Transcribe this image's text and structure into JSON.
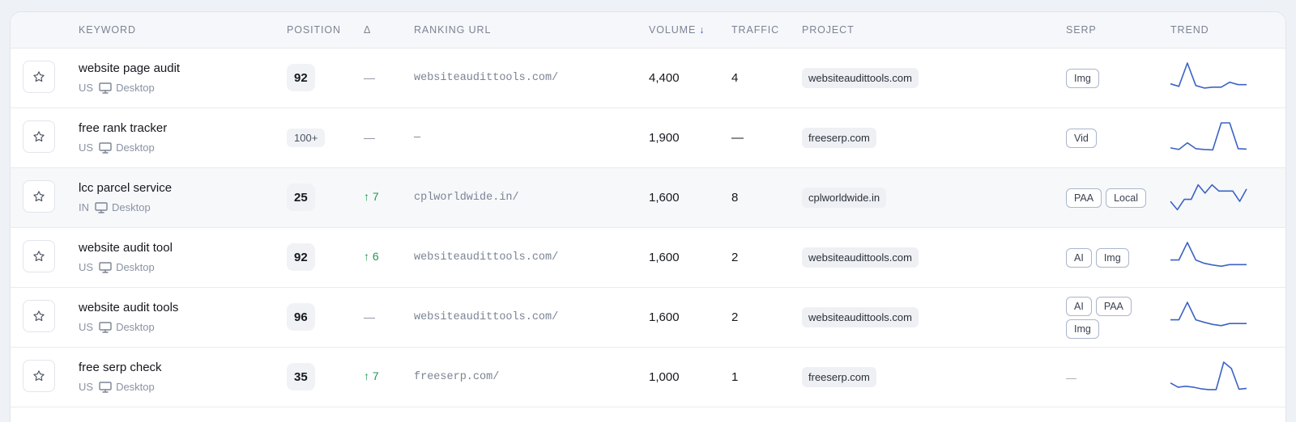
{
  "columns": {
    "keyword": "KEYWORD",
    "position": "POSITION",
    "delta": "Δ",
    "ranking_url": "RANKING URL",
    "volume": "VOLUME",
    "traffic": "TRAFFIC",
    "project": "PROJECT",
    "serp": "SERP",
    "trend": "TREND"
  },
  "sort": {
    "column": "volume",
    "direction": "descending",
    "icon": "arrow-down-icon"
  },
  "icons": {
    "star": "star-icon",
    "device": "monitor-icon"
  },
  "colors": {
    "accent": "#3b63c4",
    "positive": "#1e9a52",
    "trend_line": "#3b63c4"
  },
  "rows": [
    {
      "keyword": "website page audit",
      "country": "US",
      "device": "Desktop",
      "position": "92",
      "delta": "—",
      "delta_dir": "none",
      "url": "websiteaudittools.com/",
      "volume": "4,400",
      "traffic": "4",
      "project": "websiteaudittools.com",
      "serp": [
        "Img"
      ],
      "trend": [
        6,
        6.6,
        1,
        6.4,
        7,
        6.8,
        6.8,
        5.6,
        6.2,
        6.2
      ]
    },
    {
      "keyword": "free rank tracker",
      "country": "US",
      "device": "Desktop",
      "position": "100+",
      "delta": "—",
      "delta_dir": "none",
      "url": "—",
      "volume": "1,900",
      "traffic": "—",
      "project": "freeserp.com",
      "serp": [
        "Vid"
      ],
      "trend": [
        7,
        7.4,
        5.8,
        7.2,
        7.4,
        7.5,
        1,
        1,
        7.2,
        7.3
      ]
    },
    {
      "keyword": "lcc parcel service",
      "country": "IN",
      "device": "Desktop",
      "position": "25",
      "delta": "7",
      "delta_dir": "up",
      "url": "cplworldwide.in/",
      "volume": "1,600",
      "traffic": "8",
      "project": "cplworldwide.in",
      "serp": [
        "PAA",
        "Local"
      ],
      "trend": [
        5.5,
        7.5,
        5,
        5,
        1.5,
        3.5,
        1.5,
        3,
        3,
        3,
        5.5,
        2.5
      ]
    },
    {
      "keyword": "website audit tool",
      "country": "US",
      "device": "Desktop",
      "position": "92",
      "delta": "6",
      "delta_dir": "up",
      "url": "websiteaudittools.com/",
      "volume": "1,600",
      "traffic": "2",
      "project": "websiteaudittools.com",
      "serp": [
        "AI",
        "Img"
      ],
      "trend": [
        5.2,
        5.2,
        1,
        5.2,
        6,
        6.4,
        6.7,
        6.3,
        6.3,
        6.3
      ]
    },
    {
      "keyword": "website audit tools",
      "country": "US",
      "device": "Desktop",
      "position": "96",
      "delta": "—",
      "delta_dir": "none",
      "url": "websiteaudittools.com/",
      "volume": "1,600",
      "traffic": "2",
      "project": "websiteaudittools.com",
      "serp": [
        "AI",
        "PAA",
        "Img"
      ],
      "trend": [
        5.2,
        5.2,
        1,
        5.2,
        5.8,
        6.3,
        6.6,
        6.1,
        6.1,
        6.1
      ]
    },
    {
      "keyword": "free serp check",
      "country": "US",
      "device": "Desktop",
      "position": "35",
      "delta": "7",
      "delta_dir": "up",
      "url": "freeserp.com/",
      "volume": "1,000",
      "traffic": "1",
      "project": "freeserp.com",
      "serp": [],
      "serp_empty": "—",
      "trend": [
        6,
        7,
        6.8,
        7,
        7.4,
        7.6,
        7.6,
        1,
        2.5,
        7.5,
        7.3
      ]
    }
  ]
}
